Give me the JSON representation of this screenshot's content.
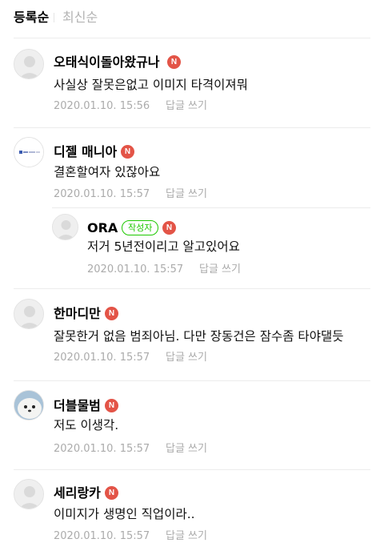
{
  "sort": {
    "active": "등록순",
    "inactive": "최신순"
  },
  "badge_label": "N",
  "writer_badge": "작성자",
  "reply_label": "답글 쓰기",
  "comments": [
    {
      "nickname": "오태식이돌아왔규나",
      "text": "사실상 잘못은없고 이미지 타격이져뭐",
      "date": "2020.01.10. 15:56"
    },
    {
      "nickname": "디젤 매니아",
      "text": "결혼할여자 있잖아요",
      "date": "2020.01.10. 15:57"
    },
    {
      "nickname": "ORA",
      "text": "저거 5년전이리고 알고있어요",
      "date": "2020.01.10. 15:57"
    },
    {
      "nickname": "한마디만",
      "text": "잘못한거 없음 범죄아님. 다만 장동건은 잠수좀 타야댈듯",
      "date": "2020.01.10. 15:57"
    },
    {
      "nickname": "더블물범",
      "text": "저도 이생각.",
      "date": "2020.01.10. 15:57"
    },
    {
      "nickname": "세리랑카",
      "text": "이미지가 생명인 직업이라..",
      "date": "2020.01.10. 15:57"
    }
  ],
  "colors": {
    "badge_red": "#e35447",
    "writer_green": "#1ec800",
    "muted_text": "#ababab"
  }
}
